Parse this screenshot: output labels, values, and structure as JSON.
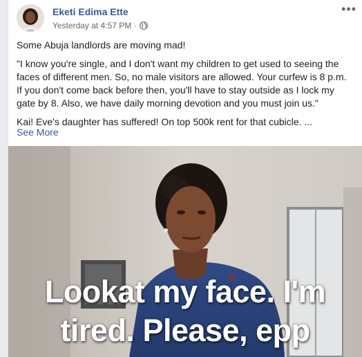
{
  "post": {
    "author_name": "Eketi Edima Ette",
    "timestamp": "Yesterday at 4:57 PM",
    "separator": "·",
    "privacy_icon": "globe-icon",
    "more_icon": "more-options-icon",
    "more_label": "•••",
    "paragraphs": [
      "Some Abuja landlords are moving mad!",
      "\"I know you're single, and I don't want my children to get used to seeing the faces of different men. So, no male visitors are allowed. Your curfew is 8 p.m. If you don't come back before then, you'll have to stay outside as I lock my gate by 8. Also, we have daily morning devotion and you must join us.\"",
      "Kai! Eve's daughter has suffered! On top 500k rent for that cubicle. ..."
    ],
    "see_more": "See More"
  },
  "image": {
    "caption_line1": "Lookat my face. I'm",
    "caption_line2": "tired. Please, epp"
  },
  "colors": {
    "link": "#385898",
    "meta": "#616770",
    "background": "#e9ebee"
  }
}
